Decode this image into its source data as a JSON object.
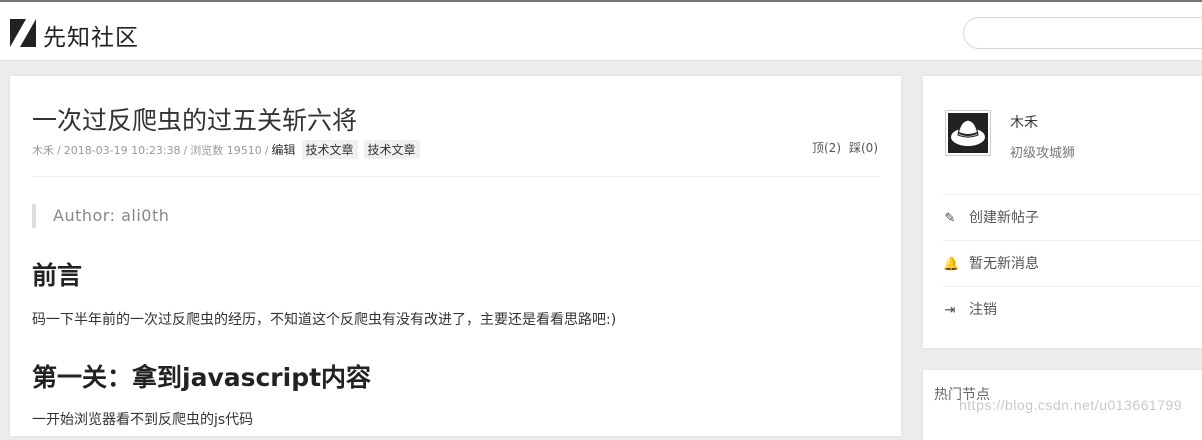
{
  "header": {
    "site_name": "先知社区",
    "logo_icon": "slash-logo-icon",
    "search_placeholder": ""
  },
  "article": {
    "title": "一次过反爬虫的过五关斩六将",
    "author": "木禾",
    "date": "2018-03-19 10:23:38",
    "views": "浏览数 19510",
    "edit_label": "编辑",
    "tags": [
      "技术文章",
      "技术文章"
    ],
    "upvote": "顶(2)",
    "downvote": "踩(0)",
    "quote": "Author: ali0th",
    "h_preface": "前言",
    "p_preface": "码一下半年前的一次过反爬虫的经历，不知道这个反爬虫有没有改进了，主要还是看看思路吧:)",
    "h_first": "第一关：拿到javascript内容",
    "p_first": "一开始浏览器看不到反爬虫的js代码"
  },
  "sidebar": {
    "user_name": "木禾",
    "user_rank": "初级攻城狮",
    "menu": [
      {
        "label": "创建新帖子",
        "icon": "pencil-icon"
      },
      {
        "label": "暂无新消息",
        "icon": "bell-icon"
      },
      {
        "label": "注销",
        "icon": "sign-out-icon"
      }
    ],
    "hot_nodes_title": "热门节点"
  },
  "watermark": "https://blog.csdn.net/u013661799",
  "colors": {
    "background": "#ececec",
    "card": "#ffffff",
    "text": "#333333",
    "muted": "#999999"
  }
}
